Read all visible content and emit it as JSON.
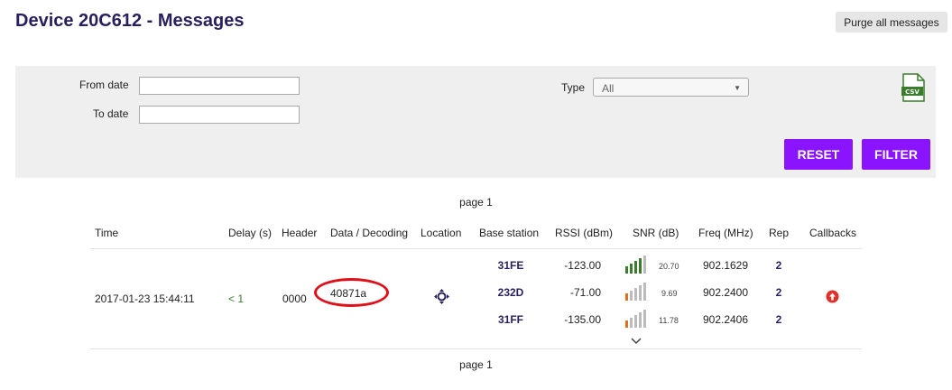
{
  "header": {
    "title": "Device 20C612 - Messages",
    "purge_label": "Purge all messages"
  },
  "filter": {
    "from_label": "From date",
    "from_value": "",
    "to_label": "To date",
    "to_value": "",
    "type_label": "Type",
    "type_value": "All",
    "csv_label": "CSV",
    "reset_label": "RESET",
    "filter_label": "FILTER"
  },
  "pagination": {
    "top": "page 1",
    "bottom": "page 1"
  },
  "table": {
    "headers": [
      "Time",
      "Delay (s)",
      "Header",
      "Data / Decoding",
      "Location",
      "Base station",
      "RSSI (dBm)",
      "SNR (dB)",
      "Freq (MHz)",
      "Rep",
      "Callbacks"
    ],
    "row": {
      "time": "2017-01-23 15:44:11",
      "delay": "< 1",
      "header": "0000",
      "data": "40871a",
      "stations": [
        {
          "base": "31FE",
          "rssi": "-123.00",
          "snr": "20.70",
          "snr_level": 4,
          "freq": "902.1629",
          "rep": "2"
        },
        {
          "base": "232D",
          "rssi": "-71.00",
          "snr": "9.69",
          "snr_level": 1,
          "freq": "902.2400",
          "rep": "2"
        },
        {
          "base": "31FF",
          "rssi": "-135.00",
          "snr": "11.78",
          "snr_level": 1,
          "freq": "902.2406",
          "rep": "2"
        }
      ]
    }
  },
  "colors": {
    "accent": "#8b14ff",
    "title": "#2a1f5e",
    "snr_good": "#3a7d2c",
    "snr_mid": "#e07020",
    "annotation": "#e0101a"
  }
}
